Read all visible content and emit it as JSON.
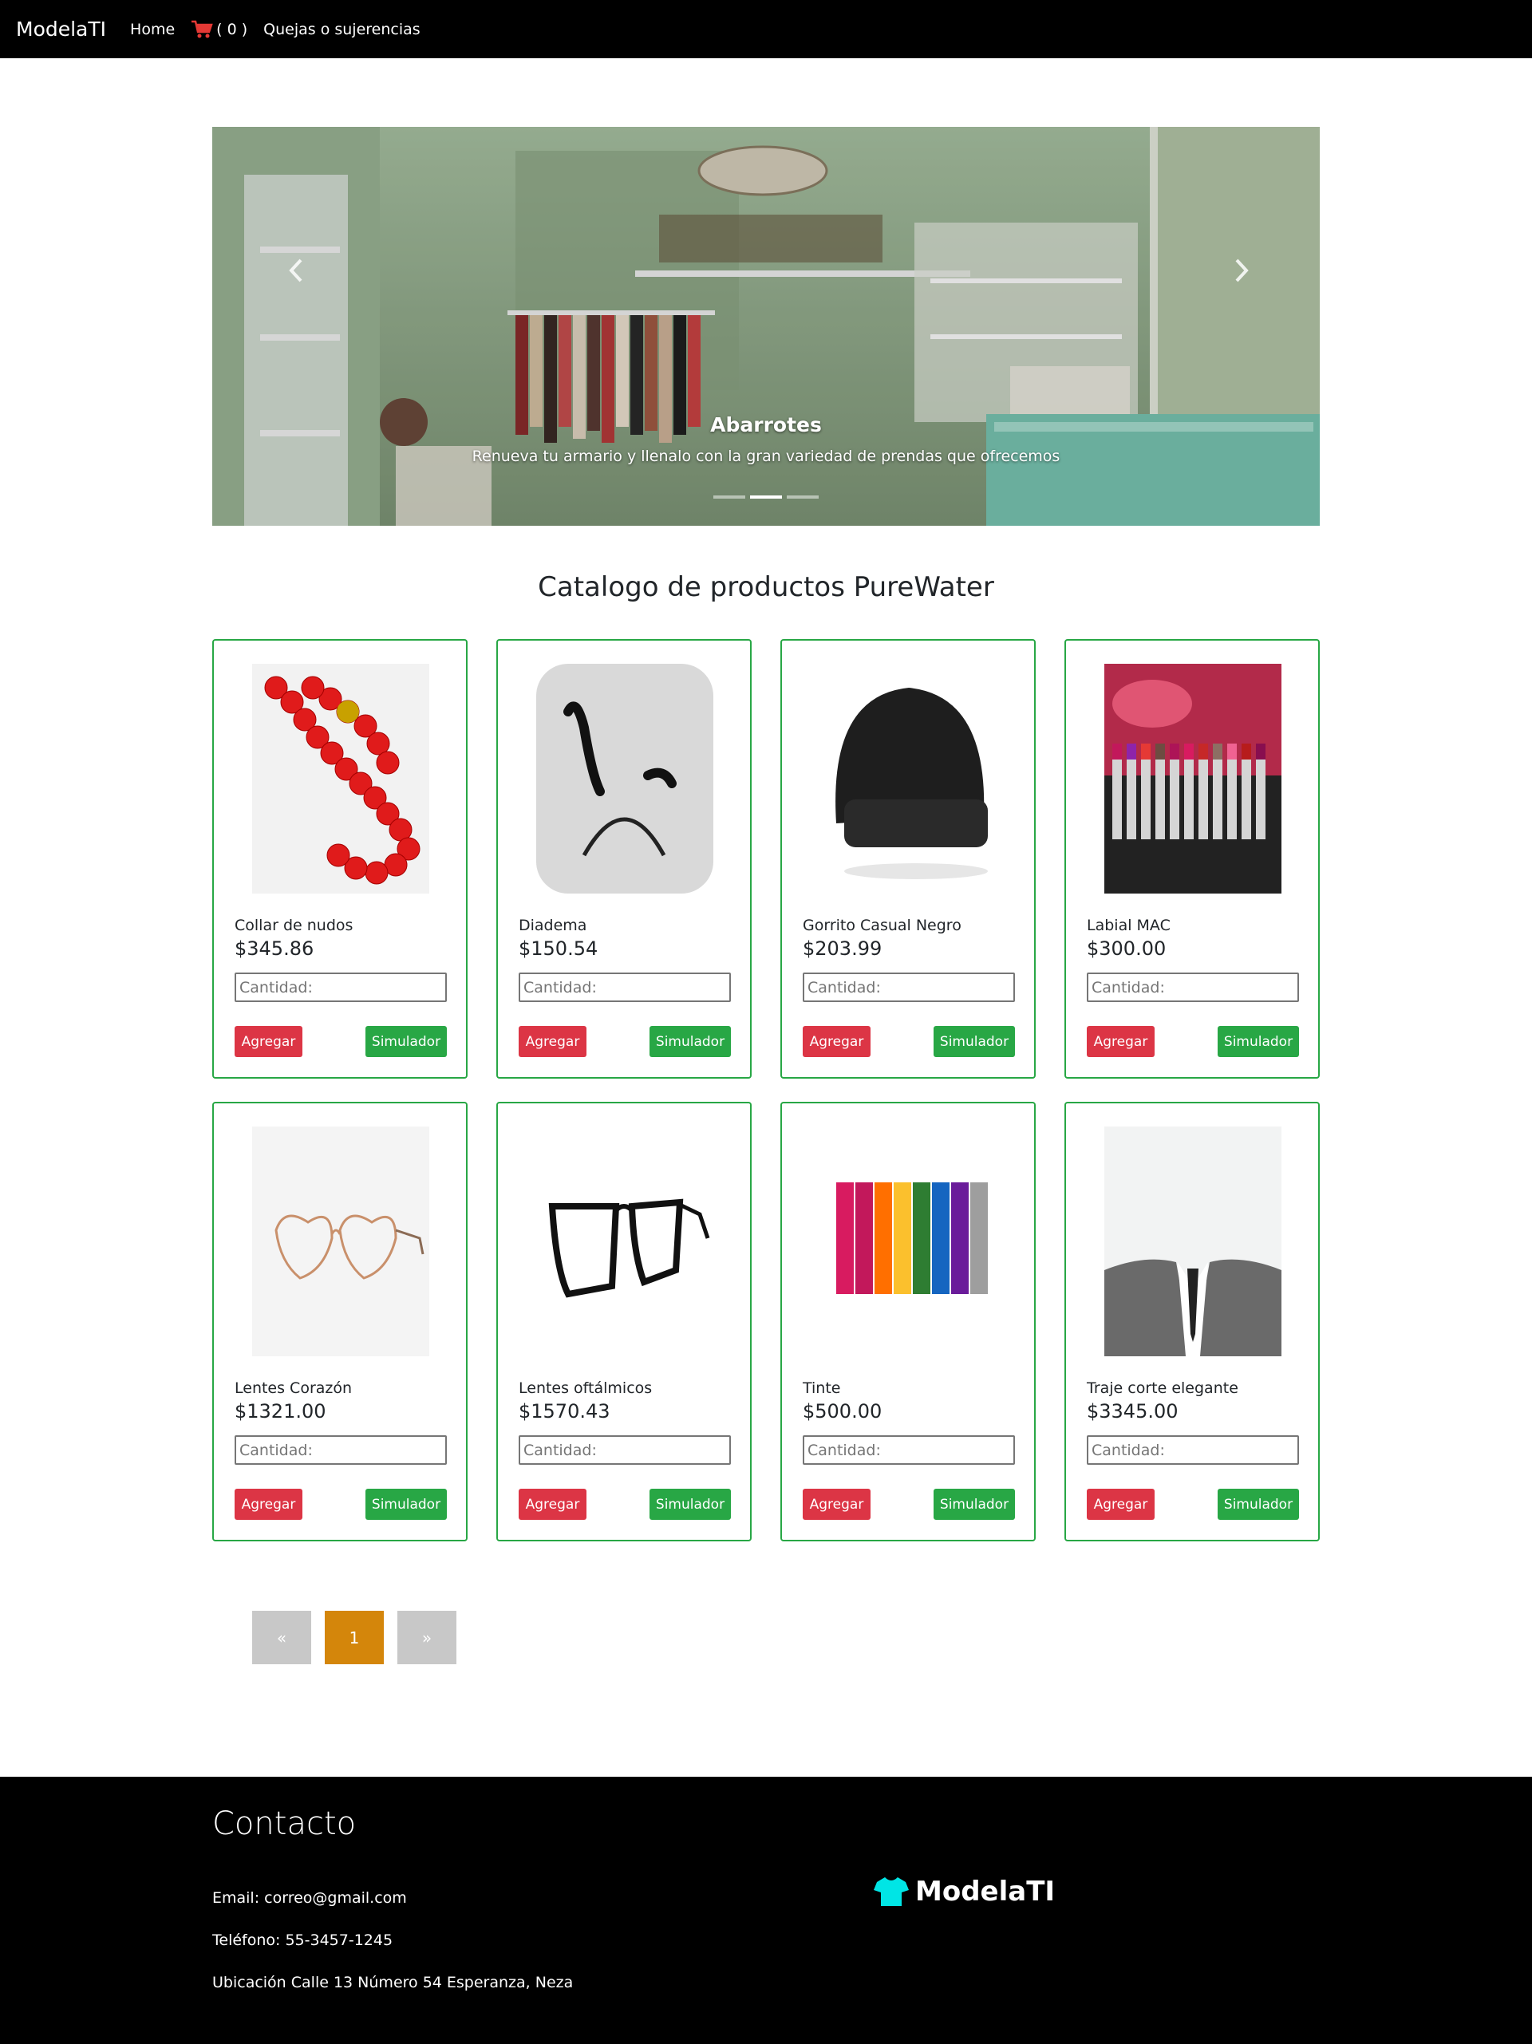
{
  "navbar": {
    "brand": "ModelaTI",
    "home": "Home",
    "cart_count": "( 0 )",
    "complaints": "Quejas o sujerencias"
  },
  "carousel": {
    "title": "Abarrotes",
    "text": "Renueva tu armario y llenalo con la gran variedad de prendas que ofrecemos",
    "prev_icon": "chevron-left-icon",
    "next_icon": "chevron-right-icon",
    "slides": 3,
    "active_slide": 2
  },
  "catalog": {
    "title": "Catalogo de productos PureWater",
    "placeholder": "Cantidad:",
    "add_label": "Agregar",
    "sim_label": "Simulador",
    "products": [
      {
        "name": "Collar de nudos",
        "price": "$345.86"
      },
      {
        "name": "Diadema",
        "price": "$150.54"
      },
      {
        "name": "Gorrito Casual Negro",
        "price": "$203.99"
      },
      {
        "name": "Labial MAC",
        "price": "$300.00"
      },
      {
        "name": "Lentes Corazón",
        "price": "$1321.00"
      },
      {
        "name": "Lentes oftálmicos",
        "price": "$1570.43"
      },
      {
        "name": "Tinte",
        "price": "$500.00"
      },
      {
        "name": "Traje corte elegante",
        "price": "$3345.00"
      }
    ]
  },
  "pagination": {
    "prev": "«",
    "current": "1",
    "next": "»"
  },
  "footer": {
    "title": "Contacto",
    "email": "Email: correo@gmail.com",
    "phone": "Teléfono: 55-3457-1245",
    "location": "Ubicación Calle 13 Número 54 Esperanza, Neza",
    "brand": "ModelaTI"
  },
  "colors": {
    "accent_green": "#28a745",
    "danger_red": "#dc3545",
    "page_active": "#d4860b",
    "brand_cyan": "#00e5e5"
  }
}
